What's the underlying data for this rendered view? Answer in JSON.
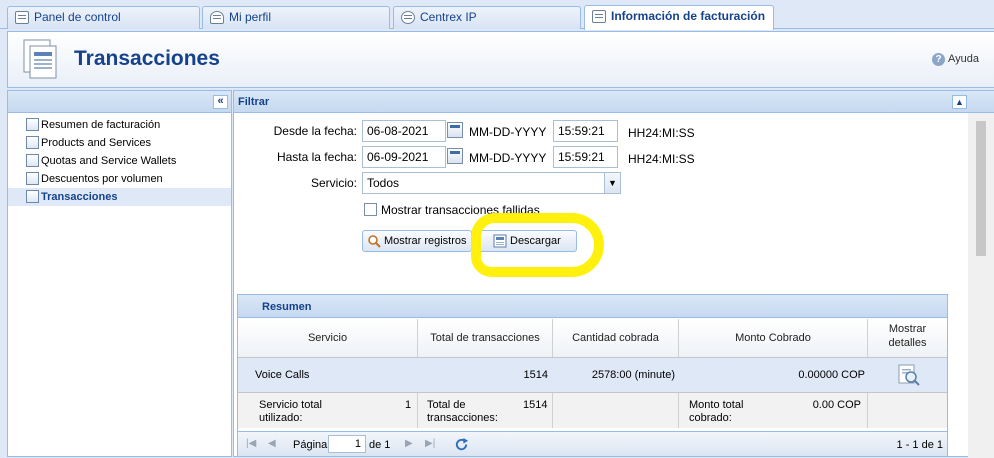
{
  "tabs": [
    {
      "label": "Panel de control",
      "icon": "control-panel-icon"
    },
    {
      "label": "Mi perfil",
      "icon": "person-icon"
    },
    {
      "label": "Centrex IP",
      "icon": "gear-icon"
    },
    {
      "label": "Información de facturación",
      "icon": "billing-icon",
      "active": true
    }
  ],
  "header": {
    "title": "Transacciones",
    "help_label": "Ayuda"
  },
  "sidebar": {
    "collapse_label": "«",
    "items": [
      {
        "label": "Resumen de facturación"
      },
      {
        "label": "Products and Services"
      },
      {
        "label": "Quotas and Service Wallets"
      },
      {
        "label": "Descuentos por volumen"
      },
      {
        "label": "Transacciones",
        "selected": true
      }
    ]
  },
  "filter": {
    "title": "Filtrar",
    "from_label": "Desde la fecha:",
    "from_date": "06-08-2021",
    "from_date_format": "MM-DD-YYYY",
    "from_time": "15:59:21",
    "from_time_format": "HH24:MI:SS",
    "to_label": "Hasta la fecha:",
    "to_date": "06-09-2021",
    "to_date_format": "MM-DD-YYYY",
    "to_time": "15:59:21",
    "to_time_format": "HH24:MI:SS",
    "service_label": "Servicio:",
    "service_value": "Todos",
    "failed_label": "Mostrar transacciones fallidas",
    "show_button": "Mostrar registros",
    "download_button": "Descargar"
  },
  "summary": {
    "title": "Resumen",
    "columns": [
      "Servicio",
      "Total de transacciones",
      "Cantidad cobrada",
      "Monto Cobrado",
      "Mostrar detalles"
    ],
    "rows": [
      {
        "service": "Voice Calls",
        "total": "1514",
        "amount": "2578:00 (minute)",
        "charged": "0.00000 COP"
      }
    ],
    "totals": {
      "service_label": "Servicio total utilizado:",
      "service_value": "1",
      "transactions_label": "Total de transacciones:",
      "transactions_value": "1514",
      "charged_label": "Monto total cobrado:",
      "charged_value": "0.00 COP"
    },
    "pager": {
      "page_label": "Página",
      "page_value": "1",
      "of_label": "de 1",
      "range": "1 - 1 de 1"
    }
  },
  "colors": {
    "accent": "#15428b",
    "panel_border": "#99bbe8",
    "highlight": "#fff000"
  }
}
